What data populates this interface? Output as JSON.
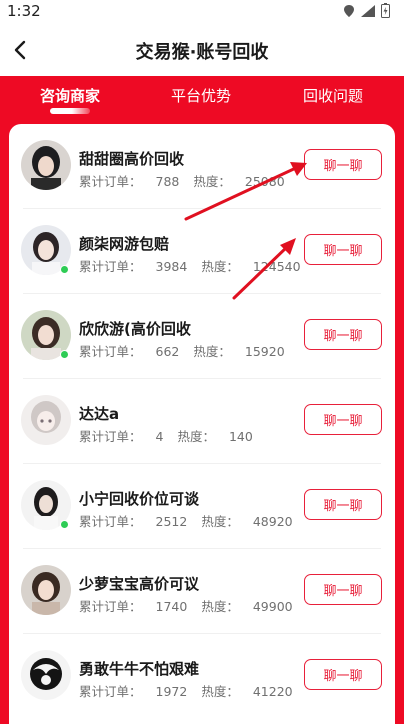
{
  "status": {
    "time": "1:32"
  },
  "header": {
    "title": "交易猴·账号回收"
  },
  "tabs": [
    {
      "label": "咨询商家"
    },
    {
      "label": "平台优势"
    },
    {
      "label": "回收问题"
    }
  ],
  "stats_labels": {
    "orders": "累计订单：",
    "heat": "热度："
  },
  "chat_label": "聊一聊",
  "merchants": [
    {
      "name": "甜甜圈高价回收",
      "orders": "788",
      "heat": "25080",
      "online": false
    },
    {
      "name": "颜柒网游包赔",
      "orders": "3984",
      "heat": "124540",
      "online": true
    },
    {
      "name": "欣欣游(高价回收",
      "orders": "662",
      "heat": "15920",
      "online": true
    },
    {
      "name": "达达a",
      "orders": "4",
      "heat": "140",
      "online": false
    },
    {
      "name": "小宁回收价位可谈",
      "orders": "2512",
      "heat": "48920",
      "online": true
    },
    {
      "name": "少萝宝宝高价可议",
      "orders": "1740",
      "heat": "49900",
      "online": false
    },
    {
      "name": "勇敢牛牛不怕艰难",
      "orders": "1972",
      "heat": "41220",
      "online": false
    }
  ],
  "colors": {
    "brand_red": "#ee0a24",
    "button_red": "#e8203a",
    "online_green": "#2ecc55",
    "annotation_arrow": "#e01020"
  }
}
